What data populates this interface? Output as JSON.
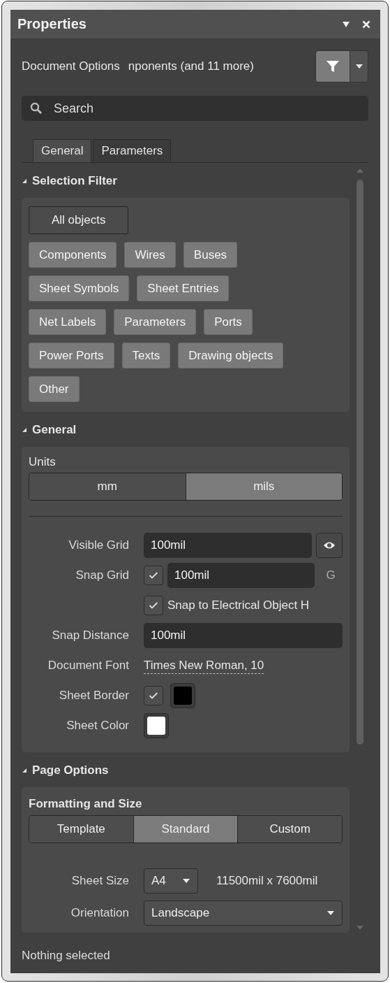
{
  "panel": {
    "title": "Properties"
  },
  "header": {
    "context": "Document Options",
    "filter_summary": "nponents (and 11 more)"
  },
  "search": {
    "placeholder": "Search"
  },
  "tabs": [
    {
      "label": "General",
      "selected": true
    },
    {
      "label": "Parameters",
      "selected": false
    }
  ],
  "sections": [
    {
      "kind": "selection_filter",
      "title": "Selection Filter",
      "expanded": true,
      "all_objects": {
        "label": "All objects",
        "on": false
      },
      "filters": [
        {
          "label": "Components",
          "on": true
        },
        {
          "label": "Wires",
          "on": true
        },
        {
          "label": "Buses",
          "on": true
        },
        {
          "label": "Sheet Symbols",
          "on": true
        },
        {
          "label": "Sheet Entries",
          "on": true
        },
        {
          "label": "Net Labels",
          "on": true
        },
        {
          "label": "Parameters",
          "on": true
        },
        {
          "label": "Ports",
          "on": true
        },
        {
          "label": "Power Ports",
          "on": true
        },
        {
          "label": "Texts",
          "on": true
        },
        {
          "label": "Drawing objects",
          "on": true
        },
        {
          "label": "Other",
          "on": true
        }
      ]
    },
    {
      "kind": "general",
      "title": "General",
      "expanded": true,
      "units_label": "Units",
      "units": [
        {
          "label": "mm",
          "selected": false
        },
        {
          "label": "mils",
          "selected": true
        }
      ],
      "fields": [
        {
          "kind": "input_eye",
          "label": "Visible Grid",
          "value": "100mil"
        },
        {
          "kind": "check_input",
          "label": "Snap Grid",
          "checked": true,
          "value": "100mil",
          "shortcut": "G"
        },
        {
          "kind": "check",
          "checked": true,
          "text": "Snap to Electrical Object H"
        },
        {
          "kind": "input",
          "label": "Snap Distance",
          "value": "100mil"
        },
        {
          "kind": "link",
          "label": "Document Font",
          "value": "Times New Roman, 10"
        },
        {
          "kind": "check_color",
          "label": "Sheet Border",
          "checked": true,
          "color": "#000000"
        },
        {
          "kind": "color",
          "label": "Sheet Color",
          "color": "#ffffff"
        }
      ]
    },
    {
      "kind": "page_options",
      "title": "Page Options",
      "expanded": true,
      "subtitle": "Formatting and Size",
      "modes": [
        {
          "label": "Template",
          "selected": false
        },
        {
          "label": "Standard",
          "selected": true
        },
        {
          "label": "Custom",
          "selected": false
        }
      ],
      "fields": [
        {
          "kind": "dropdown_info",
          "label": "Sheet Size",
          "value": "A4",
          "info": "11500mil x 7600mil"
        },
        {
          "kind": "dropdown",
          "label": "Orientation",
          "value": "Landscape"
        }
      ]
    }
  ],
  "status_bar": "Nothing selected"
}
